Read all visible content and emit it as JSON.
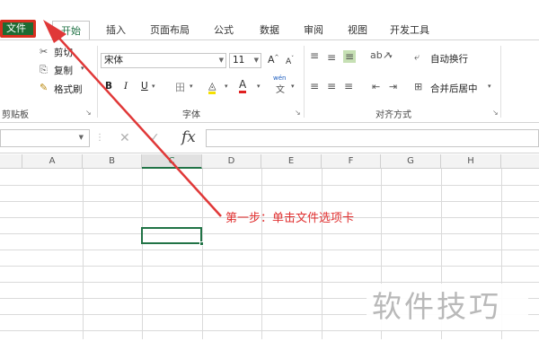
{
  "tabs": {
    "file": "文件",
    "items": [
      "开始",
      "插入",
      "页面布局",
      "公式",
      "数据",
      "审阅",
      "视图",
      "开发工具"
    ],
    "active_index": 0
  },
  "clipboard": {
    "cut": "剪切",
    "copy": "复制",
    "format_painter": "格式刷",
    "label": "剪贴板"
  },
  "font": {
    "name": "宋体",
    "size": "11",
    "bold": "B",
    "italic": "I",
    "underline": "U",
    "label": "字体",
    "wen": "wén"
  },
  "alignment": {
    "wrap_text": "自动换行",
    "merge_center": "合并后居中",
    "label": "对齐方式"
  },
  "formula": {
    "fx": "fx"
  },
  "columns": [
    "A",
    "B",
    "C",
    "D",
    "E",
    "F",
    "G",
    "H"
  ],
  "selected_column": "C",
  "annotation": "第一步：单击文件选项卡",
  "watermark": "软件技巧",
  "colors": {
    "accent": "#217346",
    "file_tab": "#1d6b32",
    "annotation": "#e03030",
    "arrow": "#e03838"
  }
}
